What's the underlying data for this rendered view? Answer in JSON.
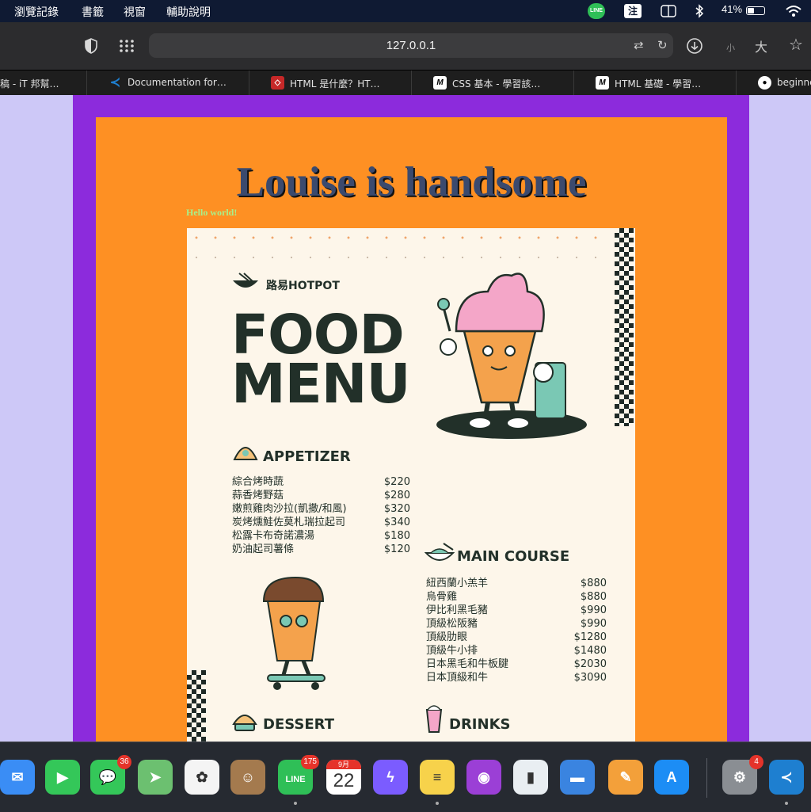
{
  "menubar": {
    "items": [
      "瀏覽記錄",
      "書籤",
      "視窗",
      "輔助說明"
    ],
    "line_label": "LINE",
    "ime_label": "注",
    "battery_text": "41%",
    "battery_level": 0.41
  },
  "toolbar": {
    "url": "127.0.0.1",
    "zoom_small": "小",
    "zoom_large": "大"
  },
  "tabs": [
    {
      "title": "稿 - iT 邦幫…",
      "icon": "ithome-icon"
    },
    {
      "title": "Documentation for…",
      "icon": "vscode-icon"
    },
    {
      "title": "HTML 是什麼？HT…",
      "icon": "html-icon"
    },
    {
      "title": "CSS 基本 - 學習該…",
      "icon": "mdn-icon"
    },
    {
      "title": "HTML 基礎 - 學習…",
      "icon": "mdn-icon"
    },
    {
      "title": "beginne",
      "icon": "github-icon"
    }
  ],
  "page": {
    "heading": "Louise is handsome",
    "subtext": "Hello world!",
    "colors": {
      "outer": "#cdc8f7",
      "purple": "#8c2bdc",
      "orange": "#fe9023",
      "heading": "#3b4a6e",
      "hello": "#a8f08a"
    }
  },
  "menu": {
    "brand": "路易HOTPOT",
    "title_line1": "FOOD",
    "title_line2": "MENU",
    "appetizer": {
      "title": "APPETIZER",
      "items": [
        {
          "name": "綜合烤時蔬",
          "price": "$220"
        },
        {
          "name": "蒜香烤野菇",
          "price": "$280"
        },
        {
          "name": "嫩煎雞肉沙拉(凱撒/和風)",
          "price": "$320"
        },
        {
          "name": "炭烤燻鮭佐莫札瑞拉起司",
          "price": "$340"
        },
        {
          "name": "松露卡布奇諾濃湯",
          "price": "$180"
        },
        {
          "name": "奶油起司薯條",
          "price": "$120"
        }
      ]
    },
    "main_course": {
      "title": "MAIN COURSE",
      "items": [
        {
          "name": "紐西蘭小羔羊",
          "price": "$880"
        },
        {
          "name": "烏骨雞",
          "price": "$880"
        },
        {
          "name": "伊比利黑毛豬",
          "price": "$990"
        },
        {
          "name": "頂級松阪豬",
          "price": "$990"
        },
        {
          "name": "頂級肋眼",
          "price": "$1280"
        },
        {
          "name": "頂級牛小排",
          "price": "$1480"
        },
        {
          "name": "日本黑毛和牛板腱",
          "price": "$2030"
        },
        {
          "name": "日本頂級和牛",
          "price": "$3090"
        }
      ]
    },
    "dessert": {
      "title": "DESSERT"
    },
    "drinks": {
      "title": "DRINKS"
    }
  },
  "dock": {
    "apps": [
      {
        "name": "mail-icon",
        "label": "✉",
        "color": "#3a8df5"
      },
      {
        "name": "facetime-icon",
        "label": "▶",
        "color": "#34c759"
      },
      {
        "name": "messages-icon",
        "label": "💬",
        "color": "#34c759",
        "badge": "36"
      },
      {
        "name": "maps-icon",
        "label": "➤",
        "color": "#6cc070"
      },
      {
        "name": "photos-icon",
        "label": "✿",
        "color": "#f4f4f4"
      },
      {
        "name": "contacts-icon",
        "label": "☺",
        "color": "#a47a4e"
      },
      {
        "name": "line-app-icon",
        "label": "LINE",
        "color": "#2fbf57",
        "badge": "175"
      },
      {
        "name": "calendar-icon",
        "label": "22",
        "color": "#ffffff",
        "month": "9月"
      },
      {
        "name": "messenger-icon",
        "label": "ϟ",
        "color": "#7b5cff"
      },
      {
        "name": "notes-icon",
        "label": "≡",
        "color": "#f7d24b"
      },
      {
        "name": "podcasts-icon",
        "label": "◉",
        "color": "#9b3fd6"
      },
      {
        "name": "numbers-icon",
        "label": "▮",
        "color": "#e9eef2"
      },
      {
        "name": "keynote-icon",
        "label": "▬",
        "color": "#3a84e0"
      },
      {
        "name": "pages-icon",
        "label": "✎",
        "color": "#f3a03a"
      },
      {
        "name": "app-store-icon",
        "label": "A",
        "color": "#1c8df5"
      },
      {
        "name": "system-preferences-icon",
        "label": "⚙",
        "color": "#8a8e93",
        "badge": "4"
      },
      {
        "name": "vscode-app-icon",
        "label": "≺",
        "color": "#1e7fd0"
      }
    ]
  }
}
